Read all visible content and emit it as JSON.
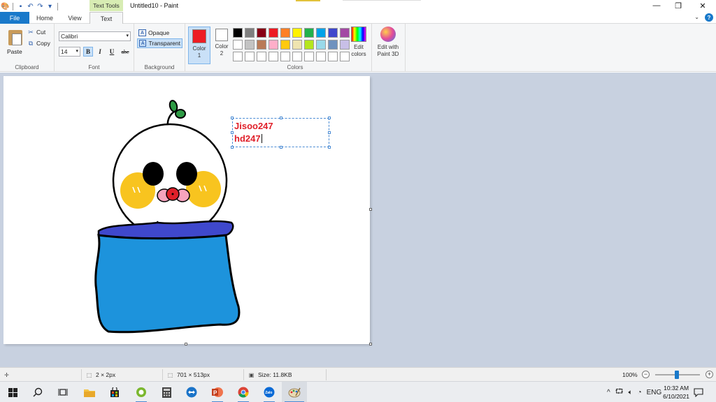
{
  "window": {
    "title": "Untitled10 - Paint",
    "context_tab": "Text Tools",
    "buttons": {
      "minimize": "—",
      "maximize": "❐",
      "close": "✕"
    }
  },
  "tabs": [
    {
      "label": "File"
    },
    {
      "label": "Home"
    },
    {
      "label": "View"
    },
    {
      "label": "Text"
    }
  ],
  "ribbon": {
    "clipboard": {
      "label": "Clipboard",
      "paste": "Paste",
      "cut": "Cut",
      "copy": "Copy"
    },
    "font": {
      "label": "Font",
      "family": "Calibri",
      "size": "14",
      "bold": "B",
      "italic": "I",
      "underline": "U",
      "strike": "abc"
    },
    "background": {
      "label": "Background",
      "opaque": "Opaque",
      "transparent": "Transparent"
    },
    "colors": {
      "label": "Colors",
      "color1_label": "Color 1",
      "color2_label": "Color 2",
      "color1": "#ed1c24",
      "color2": "#ffffff",
      "palette": [
        "#000000",
        "#7f7f7f",
        "#880015",
        "#ed1c24",
        "#ff7f27",
        "#fff200",
        "#22b14c",
        "#00a2e8",
        "#3f48cc",
        "#a349a4",
        "#ffffff",
        "#c3c3c3",
        "#b97a57",
        "#ffaec9",
        "#ffc90e",
        "#efe4b0",
        "#b5e61d",
        "#99d9ea",
        "#7092be",
        "#c8bfe7",
        "#ffffff",
        "#ffffff",
        "#ffffff",
        "#ffffff",
        "#ffffff",
        "#ffffff",
        "#ffffff",
        "#ffffff",
        "#ffffff",
        "#ffffff"
      ],
      "edit_colors": "Edit colors",
      "paint3d": "Edit with Paint 3D"
    }
  },
  "canvas": {
    "text_lines": [
      "Jisoo247",
      "hd247"
    ],
    "text_color": "#e0202a"
  },
  "status": {
    "selection_size": "2 × 2px",
    "image_size": "701 × 513px",
    "file_size": "Size: 11.8KB",
    "zoom": "100%"
  },
  "taskbar": {
    "time": "10:32 AM",
    "date": "6/10/2021"
  }
}
